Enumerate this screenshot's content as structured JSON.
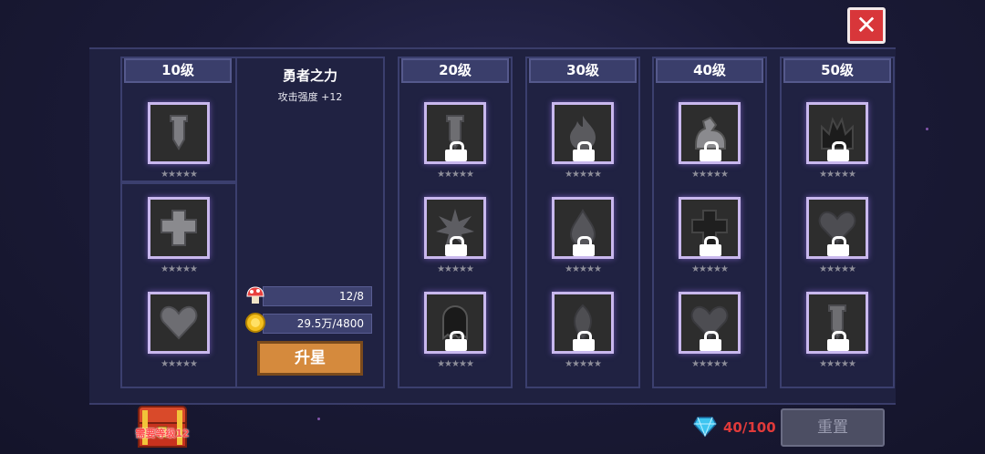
{
  "colors": {
    "accent_purple": "#c9b8ee",
    "close_red": "#d8363a",
    "upgrade_orange": "#d58a3d",
    "gem_red": "#e03a3a"
  },
  "close_icon": "close-x-icon",
  "tier_10": {
    "header": "10级",
    "slots": [
      {
        "icon": "sword-icon",
        "stars": "★★★★★"
      },
      {
        "icon": "shield-cross-icon",
        "stars": "★★★★★"
      },
      {
        "icon": "heart-icon",
        "stars": "★★★★★"
      }
    ]
  },
  "talent": {
    "name": "勇者之力",
    "effect": "攻击强度 +12",
    "resource_1": {
      "icon": "mushroom-icon",
      "value": "12/8"
    },
    "resource_2": {
      "icon": "gold-coin-icon",
      "value": "29.5万/4800"
    },
    "upgrade_label": "升星"
  },
  "tiers": [
    {
      "header": "20级",
      "slots": [
        {
          "icon": "sword-icon",
          "stars": "★★★★★",
          "locked": true
        },
        {
          "icon": "burst-icon",
          "stars": "★★★★★",
          "locked": true
        },
        {
          "icon": "ghost-icon",
          "stars": "★★★★★",
          "locked": true
        }
      ]
    },
    {
      "header": "30级",
      "slots": [
        {
          "icon": "flame-icon",
          "stars": "★★★★★",
          "locked": true
        },
        {
          "icon": "drop-icon",
          "stars": "★★★★★",
          "locked": true
        },
        {
          "icon": "leaf-icon",
          "stars": "★★★★★",
          "locked": true
        }
      ]
    },
    {
      "header": "40级",
      "slots": [
        {
          "icon": "muscle-arm-icon",
          "stars": "★★★★★",
          "locked": true
        },
        {
          "icon": "shield-cross-icon",
          "stars": "★★★★★",
          "locked": true
        },
        {
          "icon": "heart-icon",
          "stars": "★★★★★",
          "locked": true
        }
      ]
    },
    {
      "header": "50级",
      "slots": [
        {
          "icon": "crown-flame-icon",
          "stars": "★★★★★",
          "locked": true
        },
        {
          "icon": "heart-icon",
          "stars": "★★★★★",
          "locked": true
        },
        {
          "icon": "sword-icon",
          "stars": "★★★★★",
          "locked": true
        }
      ]
    }
  ],
  "footer": {
    "chest_label": "需要等级12",
    "chest_icon": "treasure-chest-icon",
    "gem_icon": "diamond-icon",
    "gem_count": "40/100",
    "reset_label": "重置"
  }
}
